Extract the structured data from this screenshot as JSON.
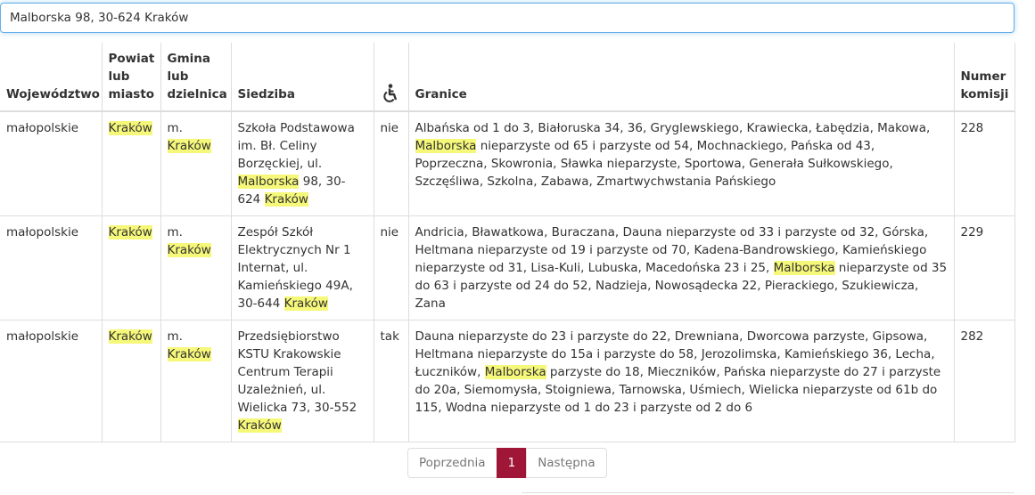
{
  "search": {
    "value": "Malborska 98, 30-624 Kraków"
  },
  "table": {
    "headers": {
      "wojewodztwo": "Województwo",
      "powiat": [
        "Powiat",
        "lub",
        "miasto"
      ],
      "gmina": [
        "Gmina",
        "lub",
        "dzielnica"
      ],
      "siedziba": "Siedziba",
      "accessibility_icon": "wheelchair-icon",
      "granice": "Granice",
      "numer": [
        "Numer",
        "komisji"
      ]
    },
    "rows": [
      {
        "wojewodztwo": "małopolskie",
        "powiat": "Kraków",
        "gmina_prefix": "m.",
        "gmina": "Kraków",
        "siedziba": {
          "before": "Szkoła Podstawowa im. Bł. Celiny Borzęckiej, ul. ",
          "hl1": "Malborska",
          "mid": " 98, 30-624 ",
          "hl2": "Kraków"
        },
        "dostepnosc": "nie",
        "granice": {
          "before": "Albańska od 1 do 3, Białoruska 34, 36, Gryglewskiego, Krawiecka, Łabędzia, Makowa, ",
          "hl": "Malborska",
          "after": " nieparzyste od 65 i parzyste od 54, Mochnackiego, Pańska od 43, Poprzeczna, Skowronia, Sławka nieparzyste, Sportowa, Generała Sułkowskiego, Szczęśliwa, Szkolna, Zabawa, Zmartwychwstania Pańskiego"
        },
        "numer": "228"
      },
      {
        "wojewodztwo": "małopolskie",
        "powiat": "Kraków",
        "gmina_prefix": "m.",
        "gmina": "Kraków",
        "siedziba": {
          "before": "Zespół Szkół Elektrycznych Nr 1 Internat, ul. Kamieńskiego 49A, 30-644 ",
          "hl": "Kraków"
        },
        "dostepnosc": "nie",
        "granice": {
          "before": "Andricia, Bławatkowa, Buraczana, Dauna nieparzyste od 33 i parzyste od 32, Górska, Heltmana nieparzyste od 19 i parzyste od 70, Kadena-Bandrowskiego, Kamieńskiego nieparzyste od 31, Lisa-Kuli, Lubuska, Macedońska 23 i 25, ",
          "hl": "Malborska",
          "after": " nieparzyste od 35 do 63 i parzyste od 24 do 52, Nadzieja, Nowosądecka 22, Pierackiego, Szukiewicza, Zana"
        },
        "numer": "229"
      },
      {
        "wojewodztwo": "małopolskie",
        "powiat": "Kraków",
        "gmina_prefix": "m.",
        "gmina": "Kraków",
        "siedziba": {
          "before": "Przedsiębiorstwo KSTU Krakowskie Centrum Terapii Uzależnień, ul. Wielicka 73, 30-552 ",
          "hl": "Kraków"
        },
        "dostepnosc": "tak",
        "granice": {
          "before": "Dauna nieparzyste do 23 i parzyste do 22, Drewniana, Dworcowa parzyste, Gipsowa, Heltmana nieparzyste do 15a i parzyste do 58, Jerozolimska, Kamieńskiego 36, Lecha, Łuczników, ",
          "hl": "Malborska",
          "after": " parzyste do 18, Mieczników, Pańska nieparzyste do 27 i parzyste do 20a, Siemomysła, Stoigniewa, Tarnowska, Uśmiech, Wielicka nieparzyste od 61b do 115, Wodna nieparzyste od 1 do 23 i parzyste od 2 do 6"
        },
        "numer": "282"
      }
    ]
  },
  "pagination": {
    "prev": "Poprzednia",
    "current": "1",
    "next": "Następna"
  },
  "colors": {
    "highlight": "#f6f87a",
    "active_page": "#a01636",
    "focus_border": "#66afe9"
  }
}
